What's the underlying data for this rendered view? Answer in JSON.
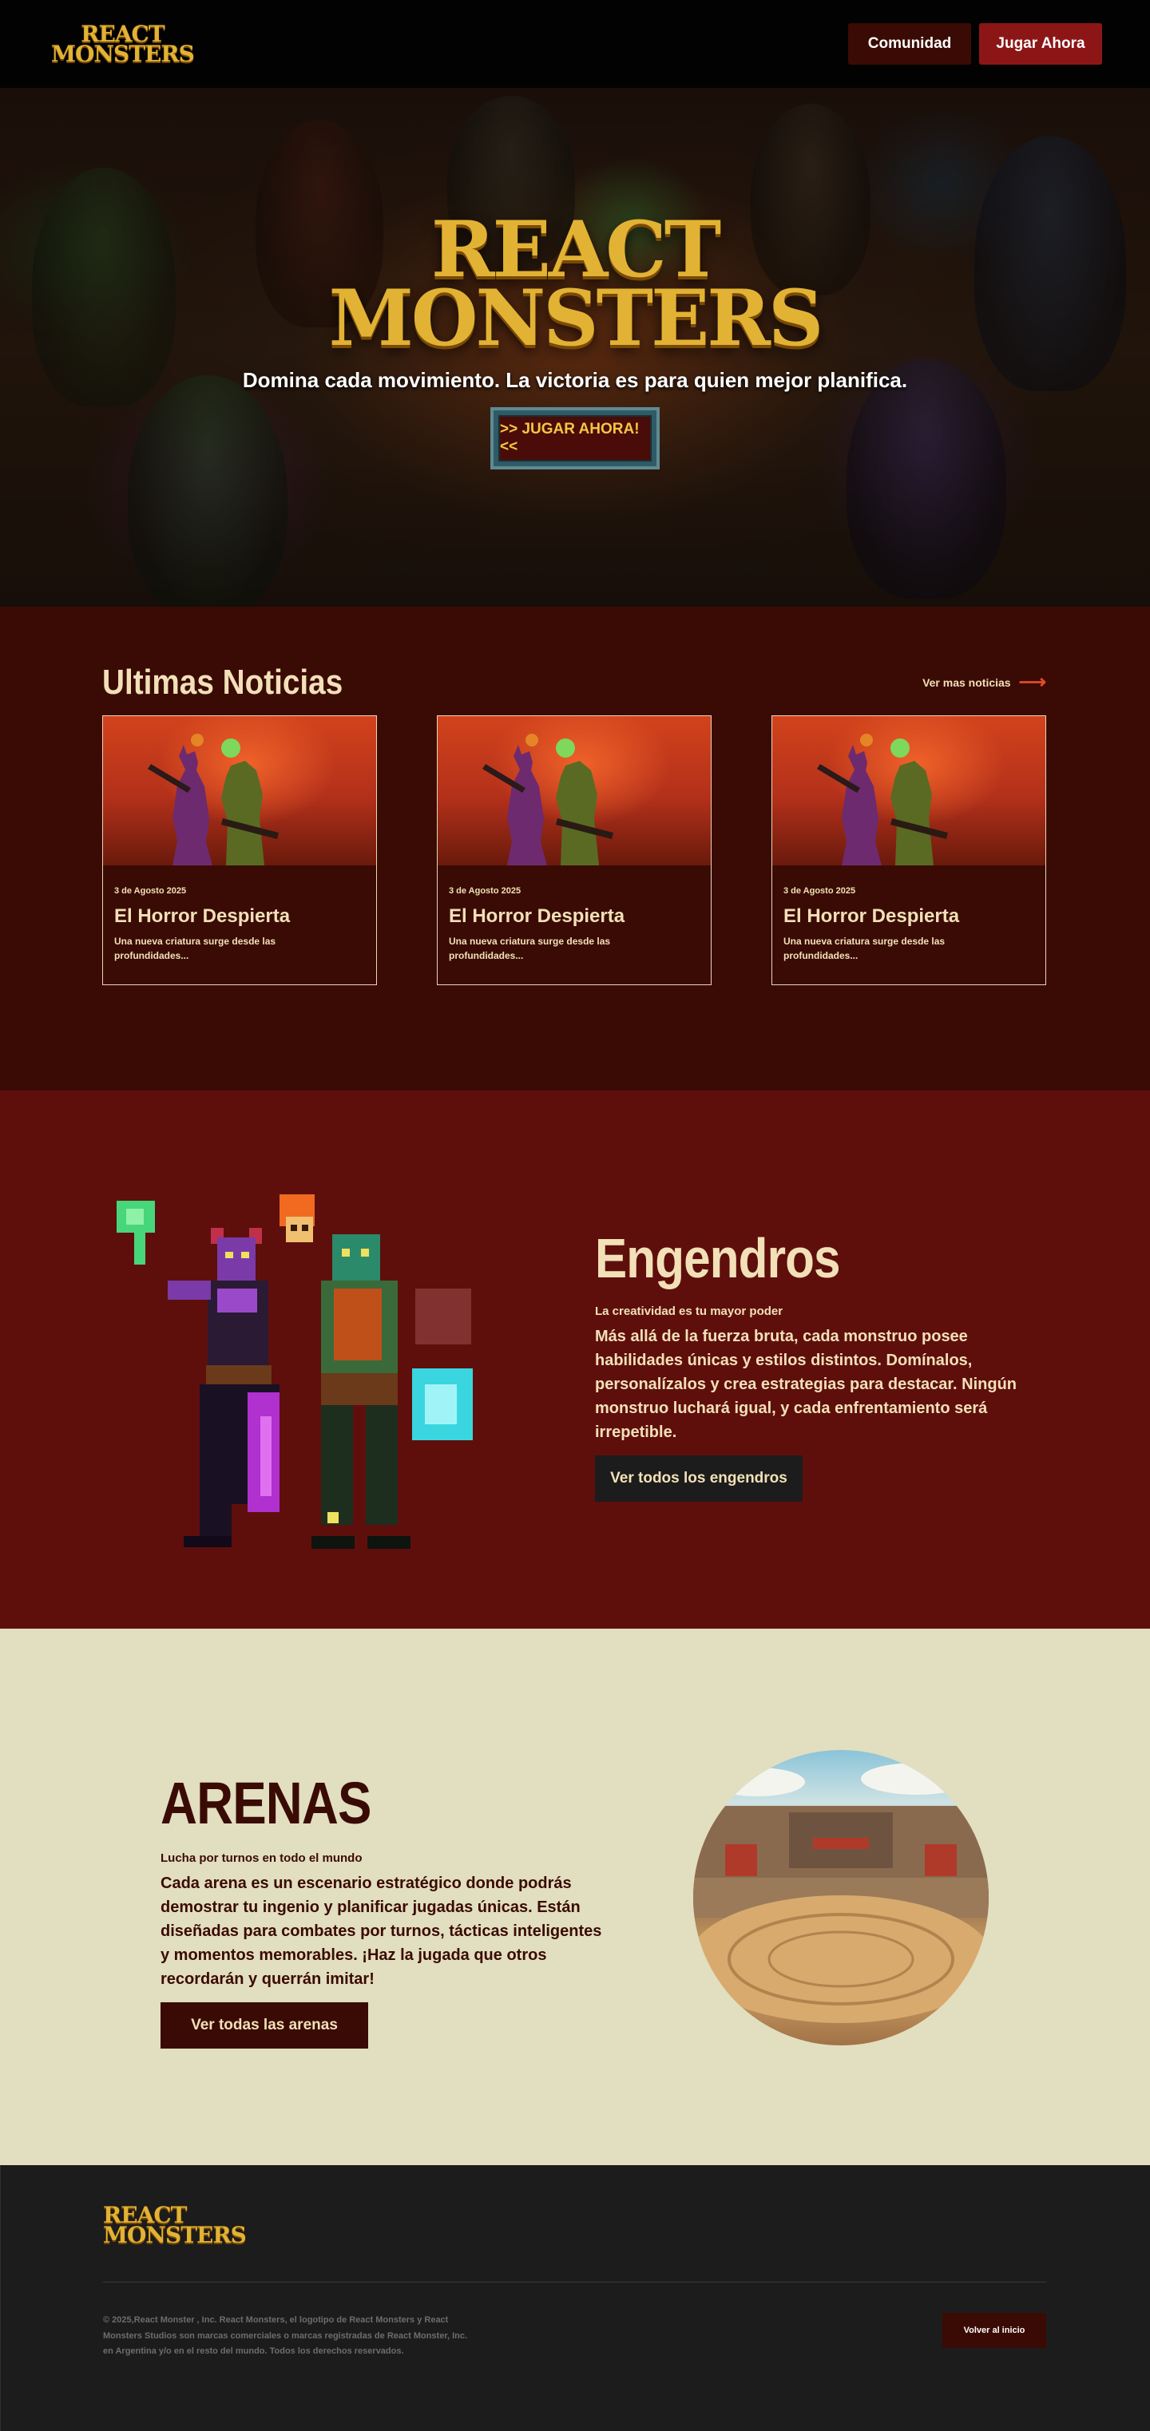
{
  "header": {
    "logo_line1": "REACT",
    "logo_line2": "MONSTERS",
    "community_label": "Comunidad",
    "play_label": "Jugar Ahora"
  },
  "hero": {
    "logo_line1": "REACT",
    "logo_line2": "MONSTERS",
    "tagline": "Domina cada movimiento. La victoria es para quien mejor planifica.",
    "cta_label": ">> JUGAR AHORA! <<"
  },
  "news": {
    "title": "Ultimas Noticias",
    "more_label": "Ver mas noticias",
    "cards": [
      {
        "date": "3 de Agosto 2025",
        "title": "El Horror Despierta",
        "desc": "Una nueva criatura surge desde las profundidades..."
      },
      {
        "date": "3 de Agosto 2025",
        "title": "El Horror Despierta",
        "desc": "Una nueva criatura surge desde las profundidades..."
      },
      {
        "date": "3 de Agosto 2025",
        "title": "El Horror Despierta",
        "desc": "Una nueva criatura surge desde las profundidades..."
      }
    ]
  },
  "spawns": {
    "title": "Engendros",
    "subtitle": "La creatividad es tu mayor poder",
    "text": "Más allá de la fuerza bruta, cada monstruo posee habilidades únicas y estilos distintos. Domínalos, personalízalos y crea estrategias para destacar. Ningún monstruo luchará igual, y cada enfrentamiento será irrepetible.",
    "cta_label": "Ver todos los engendros"
  },
  "arenas": {
    "title": "ARENAS",
    "subtitle": "Lucha por turnos en todo el mundo",
    "text": "Cada arena es un escenario estratégico donde podrás demostrar tu ingenio y planificar jugadas únicas. Están diseñadas para combates por turnos, tácticas inteligentes y momentos memorables. ¡Haz la jugada que otros recordarán y querrán imitar!",
    "cta_label": "Ver todas las arenas"
  },
  "footer": {
    "logo_line1": "REACT",
    "logo_line2": "MONSTERS",
    "legal": "© 2025,React Monster , Inc. React Monsters, el logotipo de React Monsters y React Monsters Studios son marcas comerciales o marcas registradas de React Monster, Inc. en Argentina y/o en el resto del mundo. Todos los derechos reservados.",
    "back_label": "Volver al inicio"
  },
  "colors": {
    "header_bg": "#020202",
    "news_bg": "#3a0b04",
    "spawns_bg": "#5e0f0c",
    "arenas_bg": "#e2dec0",
    "footer_bg": "#1c1c1c",
    "gold": "#e2b234",
    "accent_red": "#8c1616",
    "cream": "#f2e0b8"
  }
}
